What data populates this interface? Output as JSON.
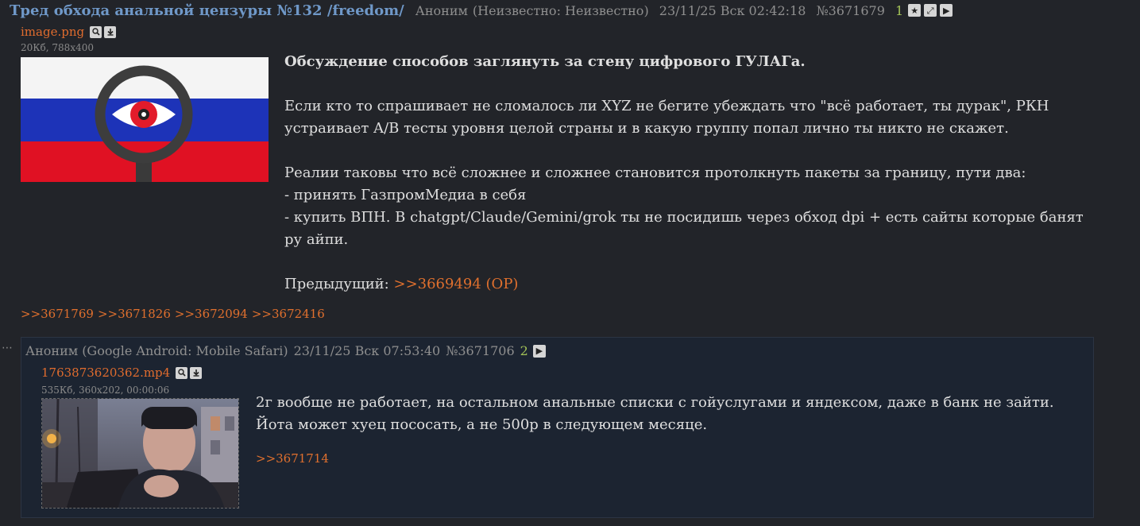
{
  "op": {
    "subject": "Тред обхода анальной цензуры №132 /freedom/",
    "name": "Аноним",
    "device": "(Неизвестно: Неизвестно)",
    "date": "23/11/25 Вск 02:42:18",
    "post_number": "№3671679",
    "count": "1",
    "file": {
      "name": "image.png",
      "meta": "20Кб, 788x400"
    },
    "text": {
      "lead": "Обсуждение способов заглянуть за стену цифрового ГУЛАГа.",
      "p1_line1": "Если кто то спрашивает не сломалось ли XYZ не бегите убеждать что \"всё работает, ты дурак\", РКН",
      "p1_line2": "устраивает A/B тесты уровня целой страны и в какую группу попал лично ты никто не скажет.",
      "p2_line1": "Реалии таковы что всё сложнее и сложнее становится протолкнуть пакеты за границу, пути два:",
      "p2_line2": "- принять ГазпромМедиа в себя",
      "p2_line3": "- купить ВПН. В chatgpt/Claude/Gemini/grok ты не посидишь через обход dpi + есть сайты которые банят",
      "p2_line4": "ру айпи.",
      "prev_label": "Предыдущий:",
      "prev_link": ">>3669494 (OP)"
    },
    "replies": [
      ">>3671769",
      ">>3671826",
      ">>3672094",
      ">>3672416"
    ]
  },
  "reply": {
    "dots": "⋯",
    "name": "Аноним",
    "device": "(Google Android: Mobile Safari)",
    "date": "23/11/25 Вск 07:53:40",
    "post_number": "№3671706",
    "count": "2",
    "file": {
      "name": "1763873620362.mp4",
      "meta": "535Кб, 360x202, 00:00:06"
    },
    "text_line1": "2г вообще не работает, на остальном анальные списки с гойуслугами и яндексом, даже в банк не зайти.",
    "text_line2": "Йота может хуец пососать, а не 500р в следующем месяце.",
    "link": ">>3671714"
  },
  "icons": {
    "star": "★",
    "expand": "⤢",
    "play": "▶",
    "search": "🔍",
    "download": "⤓"
  }
}
